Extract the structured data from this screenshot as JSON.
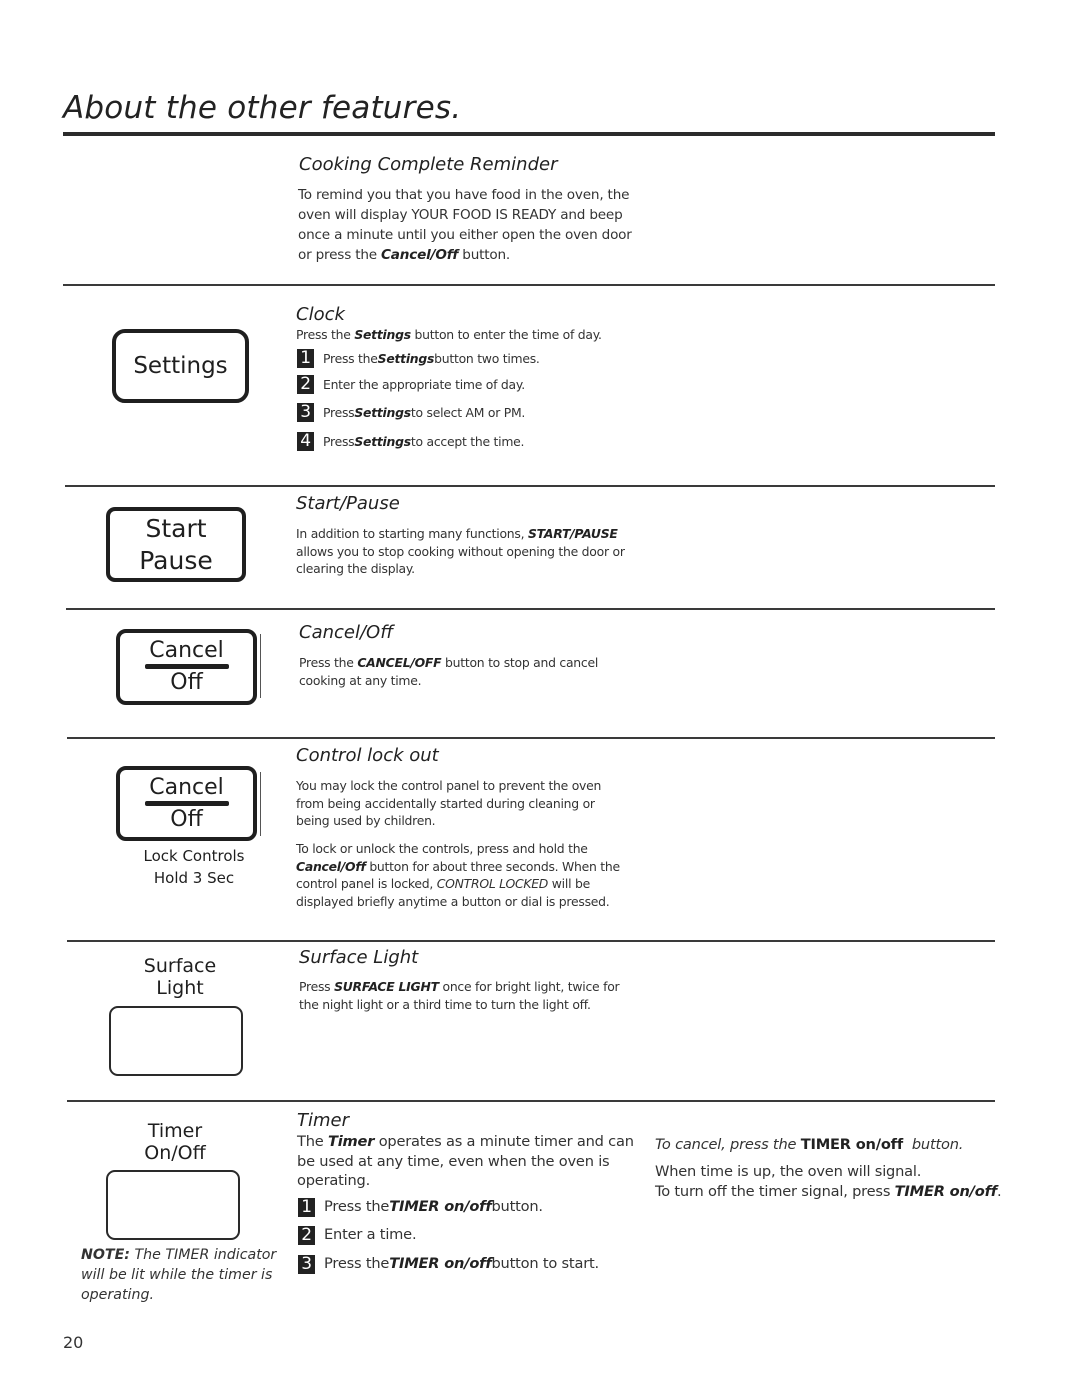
{
  "page": {
    "title": "About the other features.",
    "page_number": "20"
  },
  "cooking_complete": {
    "heading": "Cooking Complete Reminder",
    "text_1": "To remind you that you have food in the oven, the oven will display YOUR FOOD IS READY and beep once a minute until you either open the oven door or press the ",
    "text_bold": "Cancel/Off",
    "text_2": " button."
  },
  "clock": {
    "key_label": "Settings",
    "heading": "Clock",
    "intro_1": "Press the ",
    "intro_bold": "Settings",
    "intro_2": " button to enter the time of day.",
    "steps": [
      {
        "num": "1",
        "pre": "Press the ",
        "bold": "Settings",
        "post": " button two times."
      },
      {
        "num": "2",
        "pre": "Enter the appropriate time of day.",
        "bold": "",
        "post": ""
      },
      {
        "num": "3",
        "pre": "Press ",
        "bold": "Settings",
        "post": " to select AM or PM."
      },
      {
        "num": "4",
        "pre": "Press ",
        "bold": "Settings",
        "post": " to accept the time."
      }
    ]
  },
  "start_pause": {
    "key_line_1": "Start",
    "key_line_2": "Pause",
    "heading": "Start/Pause",
    "text_1": "In addition to starting many functions, ",
    "text_bold": "START/PAUSE",
    "text_2": " allows you to stop cooking without opening the door or clearing the display."
  },
  "cancel_off": {
    "key_top": "Cancel",
    "key_bottom": "Off",
    "heading": "Cancel/Off",
    "text_1": "Press the ",
    "text_bold": "CANCEL/OFF",
    "text_2": " button to stop and cancel cooking at any time."
  },
  "control_lock": {
    "key_top": "Cancel",
    "key_bottom": "Off",
    "caption_1": "Lock Controls",
    "caption_2": "Hold 3 Sec",
    "heading": "Control lock out",
    "para_1": "You may lock the control panel to prevent the oven from being accidentally started during cleaning or being used by children.",
    "para_2_pre": "To lock or unlock the controls, press and hold the ",
    "para_2_bold": "Cancel/Off",
    "para_2_mid": " button for about three seconds. When the control panel is locked, ",
    "para_2_italic": "CONTROL LOCKED",
    "para_2_post": " will be displayed briefly anytime a button or dial is pressed."
  },
  "surface_light": {
    "key_line_1": "Surface",
    "key_line_2": "Light",
    "heading": "Surface Light",
    "text_1": "Press ",
    "text_bold": "SURFACE LIGHT",
    "text_2": " once for bright light, twice for the night light or a third time to turn the light off."
  },
  "timer": {
    "key_line_1": "Timer",
    "key_line_2": "On/Off",
    "note_bold": "NOTE:",
    "note_text": " The TIMER indicator will be lit while the timer is operating.",
    "heading": "Timer",
    "intro_1": "The ",
    "intro_bold": "Timer",
    "intro_2": " operates as a minute timer and can be used at any time, even when the oven is operating.",
    "steps": [
      {
        "num": "1",
        "pre": "Press the ",
        "bold": "TIMER on/off",
        "post": " button."
      },
      {
        "num": "2",
        "pre": "Enter a time.",
        "bold": "",
        "post": ""
      },
      {
        "num": "3",
        "pre": "Press the ",
        "bold": "TIMER on/off",
        "post": " button to start."
      }
    ],
    "cancel_1": "To cancel, press the ",
    "cancel_bold": "TIMER on/off",
    "cancel_2": "  button.",
    "signal_line": "When time is up, the oven will signal.",
    "turnoff_1": "To turn off the timer signal, press ",
    "turnoff_bold": "TIMER on/off",
    "turnoff_2": "."
  }
}
